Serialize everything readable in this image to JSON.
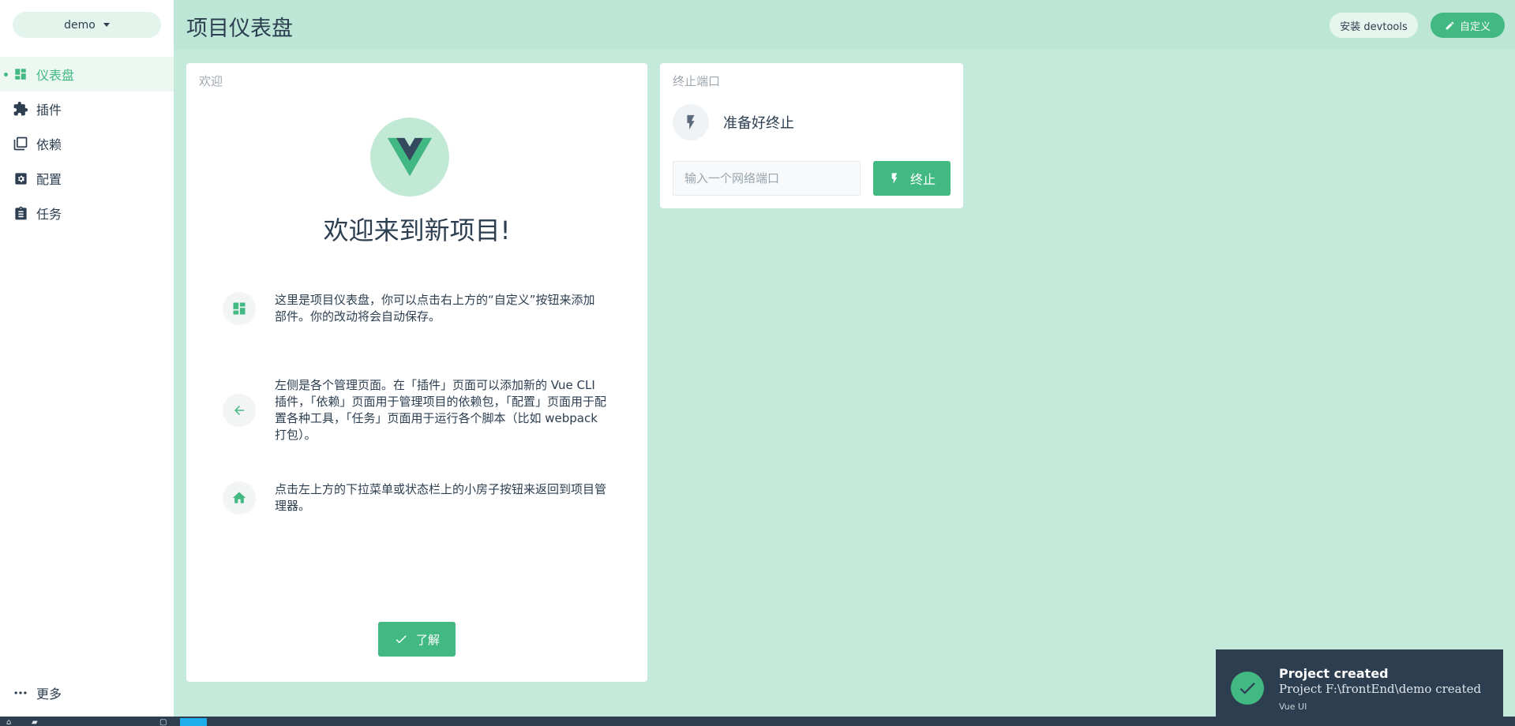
{
  "sidebar": {
    "project": "demo",
    "items": [
      {
        "label": "仪表盘",
        "icon": "dashboard-icon",
        "active": true
      },
      {
        "label": "插件",
        "icon": "puzzle-icon",
        "active": false
      },
      {
        "label": "依赖",
        "icon": "library-books-icon",
        "active": false
      },
      {
        "label": "配置",
        "icon": "settings-box-icon",
        "active": false
      },
      {
        "label": "任务",
        "icon": "clipboard-icon",
        "active": false
      }
    ],
    "more_label": "更多"
  },
  "header": {
    "title": "项目仪表盘",
    "devtools_label": "安装 devtools",
    "customize_label": "自定义"
  },
  "welcome": {
    "card_title": "欢迎",
    "heading": "欢迎来到新项目!",
    "tips": [
      {
        "icon": "dashboard-icon",
        "text": "这里是项目仪表盘，你可以点击右上方的“自定义”按钮来添加部件。你的改动将会自动保存。"
      },
      {
        "icon": "arrow-left-icon",
        "text": "左侧是各个管理页面。在「插件」页面可以添加新的 Vue CLI 插件，「依赖」页面用于管理项目的依赖包，「配置」页面用于配置各种工具，「任务」页面用于运行各个脚本（比如 webpack 打包）。"
      },
      {
        "icon": "home-icon",
        "text": "点击左上方的下拉菜单或状态栏上的小房子按钮来返回到项目管理器。"
      }
    ],
    "ok_label": "了解"
  },
  "kill_port": {
    "card_title": "终止端口",
    "status": "准备好终止",
    "input_placeholder": "输入一个网络端口",
    "input_value": "",
    "kill_label": "终止"
  },
  "toast": {
    "title": "Project created",
    "message": "Project F:\\frontEnd\\demo created",
    "source": "Vue UI"
  },
  "colors": {
    "accent": "#42b983",
    "dark": "#2c3e50",
    "background": "#c5eadc",
    "header": "#bde6d6"
  }
}
